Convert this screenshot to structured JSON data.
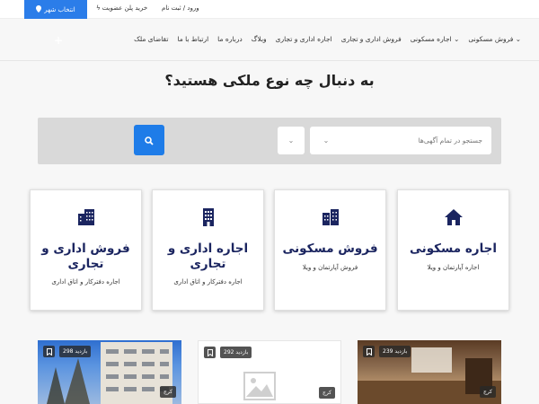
{
  "topbar": {
    "city_label": "انتخاب شهر",
    "membership_label": "خرید پلن عضویت",
    "login_label": "ورود / ثبت نام"
  },
  "nav": {
    "add_ad_label": "+",
    "items": [
      {
        "label": "فروش مسکونی ⌄"
      },
      {
        "label": "اجاره مسکونی ⌄"
      },
      {
        "label": "فروش اداری و تجاری"
      },
      {
        "label": "اجاره اداری و تجاری"
      },
      {
        "label": "وبلاگ"
      },
      {
        "label": "درباره ما"
      },
      {
        "label": "ارتباط با ما"
      },
      {
        "label": "تقاضای ملک"
      }
    ]
  },
  "hero": {
    "title": "به دنبال چه نوع ملکی هستید؟"
  },
  "search": {
    "placeholder": "جستجو در تمام آگهی‌ها",
    "select1_caret": "⌄",
    "select2_caret": "⌄"
  },
  "categories": [
    {
      "title": "اجاره مسکونی",
      "subtitle": "اجاره آپارتمان و ویلا",
      "icon": "house-icon"
    },
    {
      "title": "فروش مسکونی",
      "subtitle": "فروش آپارتمان و ویلا",
      "icon": "building-icon"
    },
    {
      "title": "اجاره اداری و تجاری",
      "subtitle": "اجاره دفترکار و اتاق اداری",
      "icon": "office-building-icon"
    },
    {
      "title": "فروش اداری و تجاری",
      "subtitle": "اجاره دفترکار و اتاق اداری",
      "icon": "office-building-icon"
    }
  ],
  "listings": [
    {
      "visits": "239 بازدید",
      "location": "کرج"
    },
    {
      "visits": "292 بازدید",
      "location": "کرج"
    },
    {
      "visits": "298 بازدید",
      "location": "کرج"
    }
  ],
  "colors": {
    "accent": "#2b7de9",
    "card_title": "#1b2560"
  }
}
